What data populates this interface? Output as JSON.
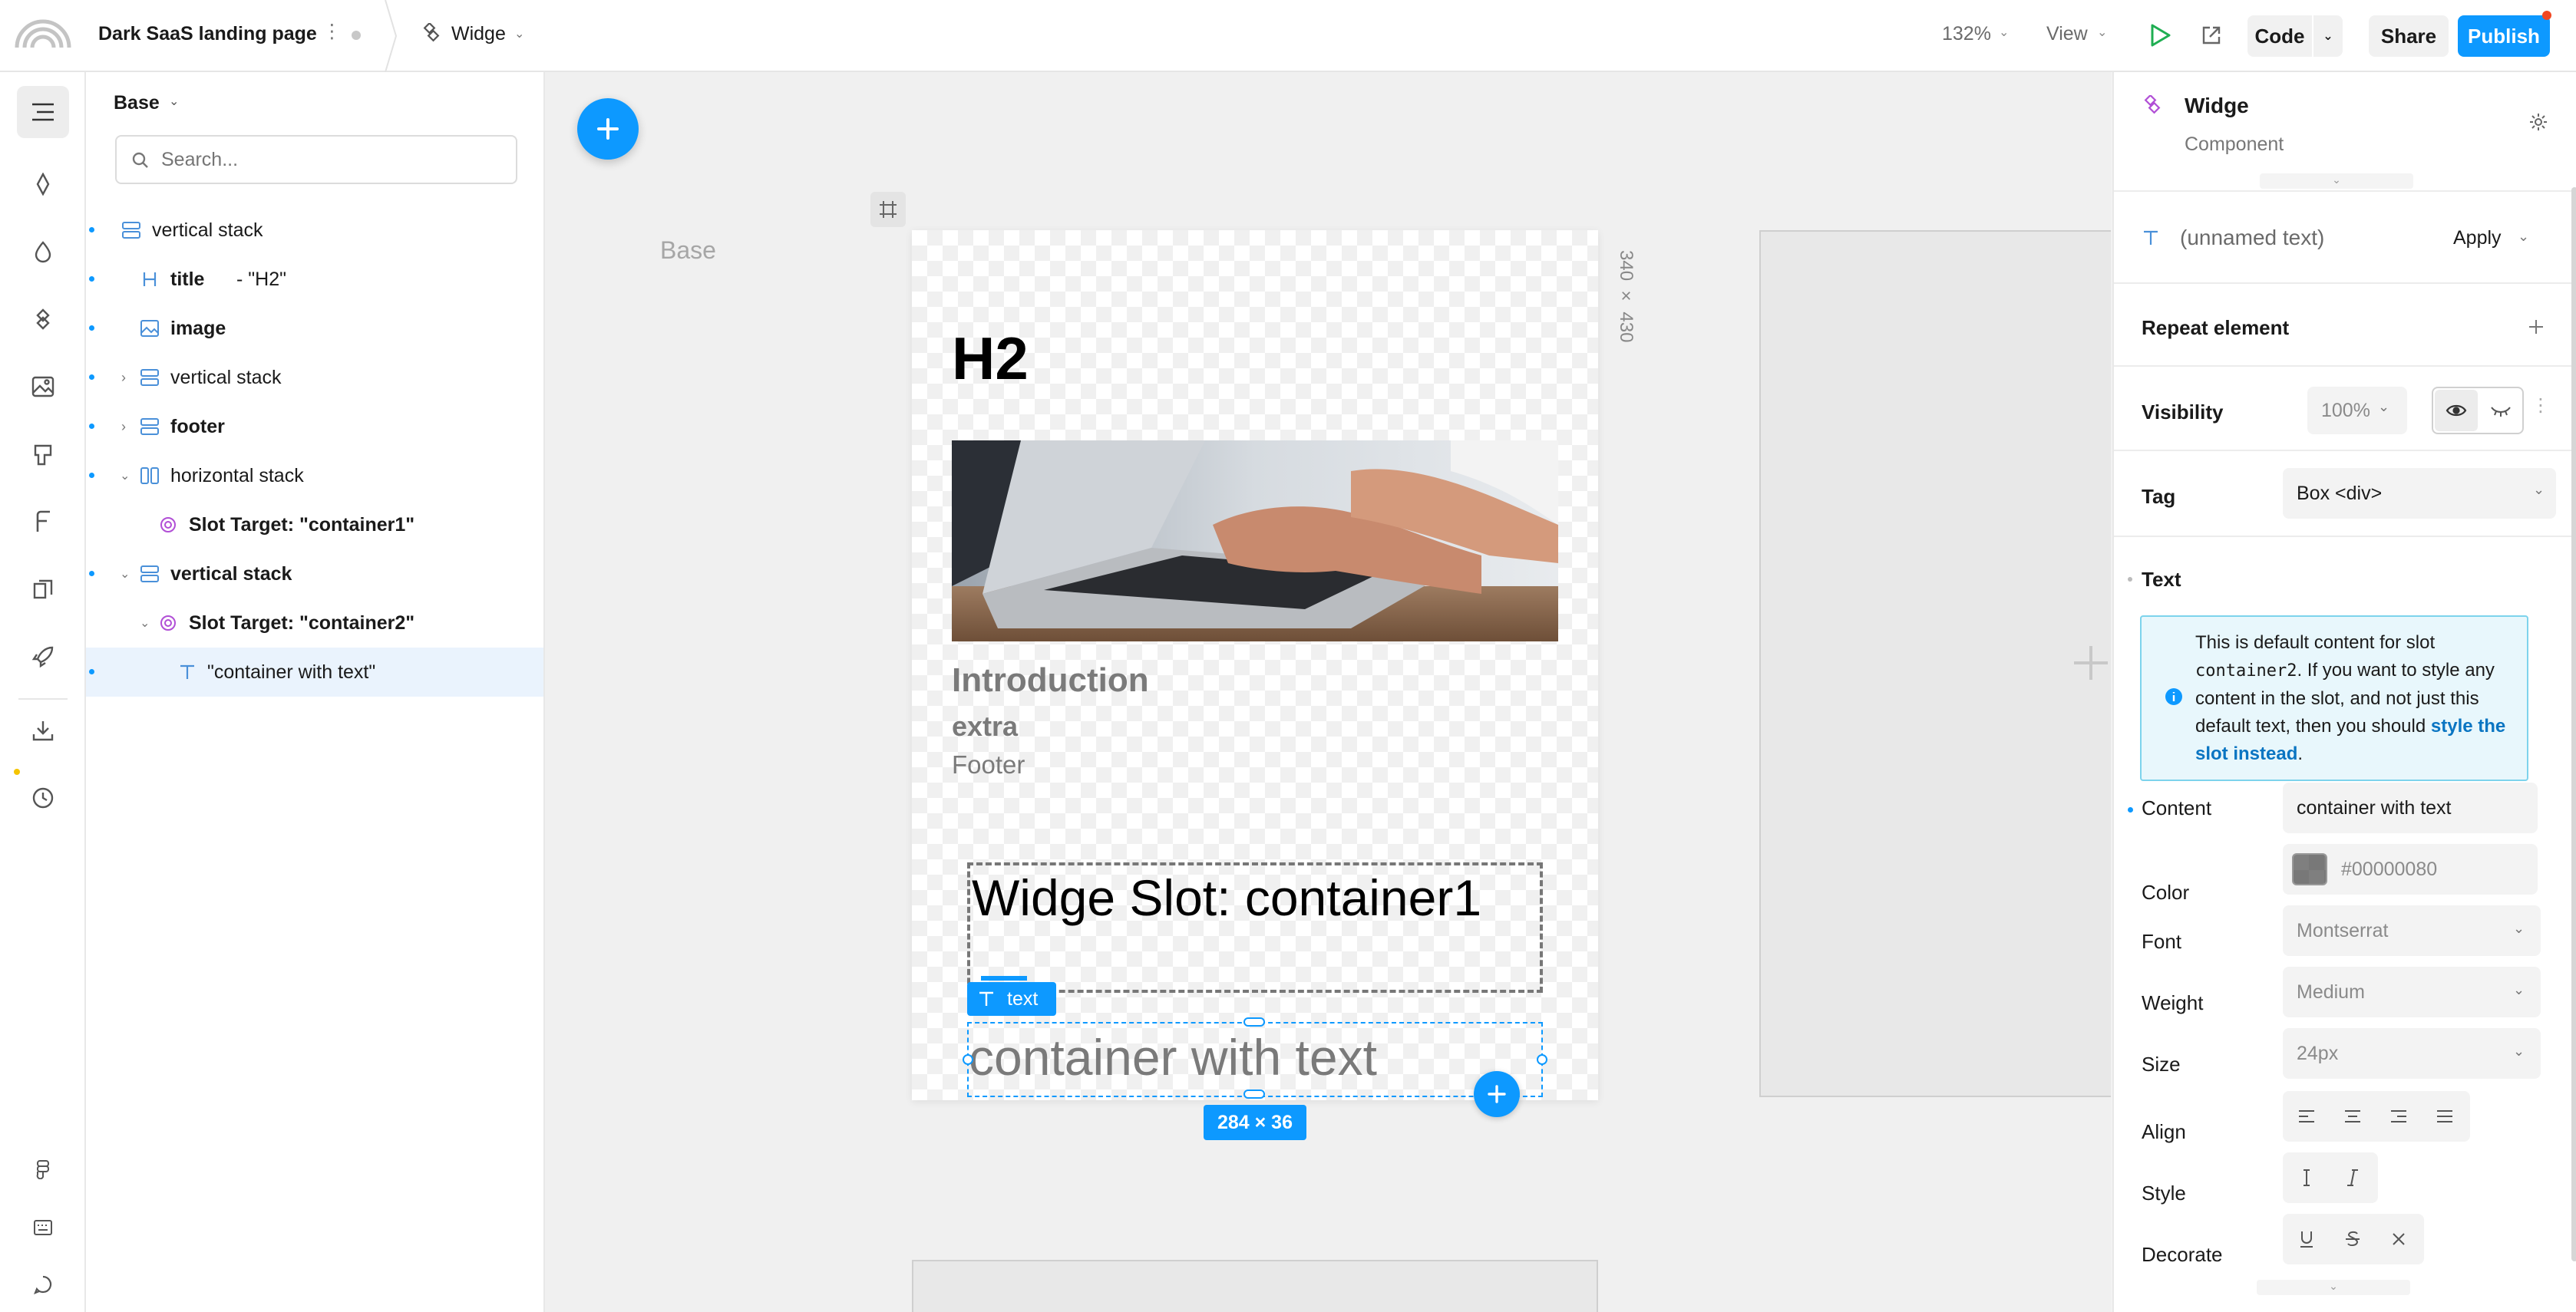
{
  "topbar": {
    "project_title": "Dark SaaS landing page",
    "component_name": "Widge",
    "zoom": "132%",
    "view_label": "View",
    "code_label": "Code",
    "share_label": "Share",
    "publish_label": "Publish"
  },
  "layers": {
    "variant_label": "Base",
    "search_placeholder": "Search...",
    "items": [
      {
        "label": "vertical stack"
      },
      {
        "label": "title",
        "suffix": "- \"H2\""
      },
      {
        "label": "image"
      },
      {
        "label": "vertical stack"
      },
      {
        "label": "footer"
      },
      {
        "label": "horizontal stack"
      },
      {
        "label": "Slot Target: \"container1\""
      },
      {
        "label": "vertical stack"
      },
      {
        "label": "Slot Target: \"container2\""
      },
      {
        "label": "\"container with text\""
      }
    ]
  },
  "canvas": {
    "variant_label": "Base",
    "frame_dims": "340 × 430",
    "heading": "H2",
    "intro": "Introduction",
    "extra": "extra",
    "footer": "Footer",
    "slot_text": "Widge Slot: container1",
    "selection_tag": "text",
    "selected_text": "container with text",
    "selection_dims": "284 × 36"
  },
  "right_panel": {
    "component_name": "Widge",
    "component_type": "Component",
    "element_name": "(unnamed text)",
    "apply_label": "Apply",
    "repeat_label": "Repeat element",
    "visibility_label": "Visibility",
    "visibility_value": "100%",
    "tag_label": "Tag",
    "tag_value": "Box <div>",
    "text_section": "Text",
    "info_part1": "This is default content for slot",
    "info_code": "container2",
    "info_part2": ". If you want to style any content in the slot, and not just this default text, then you should",
    "info_link": "style the slot instead",
    "info_end": ".",
    "content_label": "Content",
    "content_value": "container with text",
    "color_label": "Color",
    "color_value": "#00000080",
    "font_label": "Font",
    "font_value": "Montserrat",
    "weight_label": "Weight",
    "weight_value": "Medium",
    "size_label": "Size",
    "size_value": "24px",
    "align_label": "Align",
    "style_label": "Style",
    "decorate_label": "Decorate"
  },
  "colors": {
    "accent": "#0d99ff",
    "component_purple": "#b14fd6",
    "play_green": "#1fae52"
  }
}
